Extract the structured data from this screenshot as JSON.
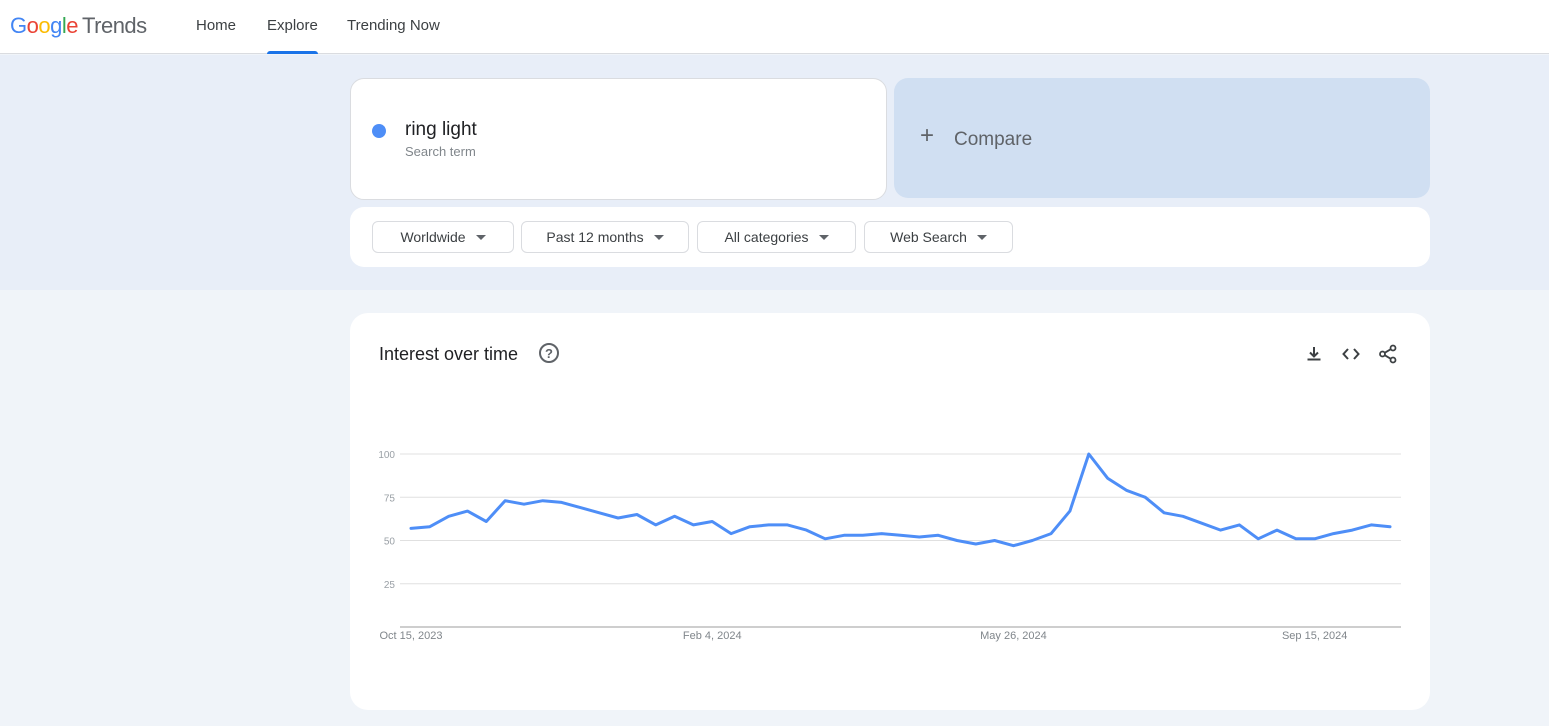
{
  "header": {
    "logo_google": [
      "G",
      "o",
      "o",
      "g",
      "l",
      "e"
    ],
    "logo_trends": "Trends",
    "nav": [
      {
        "label": "Home",
        "active": false
      },
      {
        "label": "Explore",
        "active": true
      },
      {
        "label": "Trending Now",
        "active": false
      }
    ]
  },
  "search": {
    "term": "ring light",
    "term_sub": "Search term",
    "term_color": "#4e8ef7",
    "compare_label": "Compare",
    "compare_icon": "plus-icon"
  },
  "filters": [
    {
      "label": "Worldwide"
    },
    {
      "label": "Past 12 months"
    },
    {
      "label": "All categories"
    },
    {
      "label": "Web Search"
    }
  ],
  "chart_card": {
    "title": "Interest over time",
    "help_icon": "help-icon",
    "tools": [
      "download-icon",
      "embed-icon",
      "share-icon"
    ]
  },
  "chart_data": {
    "type": "line",
    "title": "Interest over time",
    "xlabel": "",
    "ylabel": "",
    "ylim": [
      0,
      100
    ],
    "yticks": [
      25,
      50,
      75,
      100
    ],
    "grid": true,
    "x_tick_labels": [
      {
        "index": 0,
        "label": "Oct 15, 2023"
      },
      {
        "index": 16,
        "label": "Feb 4, 2024"
      },
      {
        "index": 32,
        "label": "May 26, 2024"
      },
      {
        "index": 48,
        "label": "Sep 15, 2024"
      }
    ],
    "series": [
      {
        "name": "ring light",
        "color": "#4e8ef7",
        "values": [
          57,
          58,
          64,
          67,
          61,
          73,
          71,
          73,
          72,
          69,
          66,
          63,
          65,
          59,
          64,
          59,
          61,
          54,
          58,
          59,
          59,
          56,
          51,
          53,
          53,
          54,
          53,
          52,
          53,
          50,
          48,
          50,
          47,
          50,
          54,
          67,
          100,
          86,
          79,
          75,
          66,
          64,
          60,
          56,
          59,
          51,
          56,
          51,
          51,
          54,
          56,
          59,
          58
        ]
      }
    ]
  }
}
